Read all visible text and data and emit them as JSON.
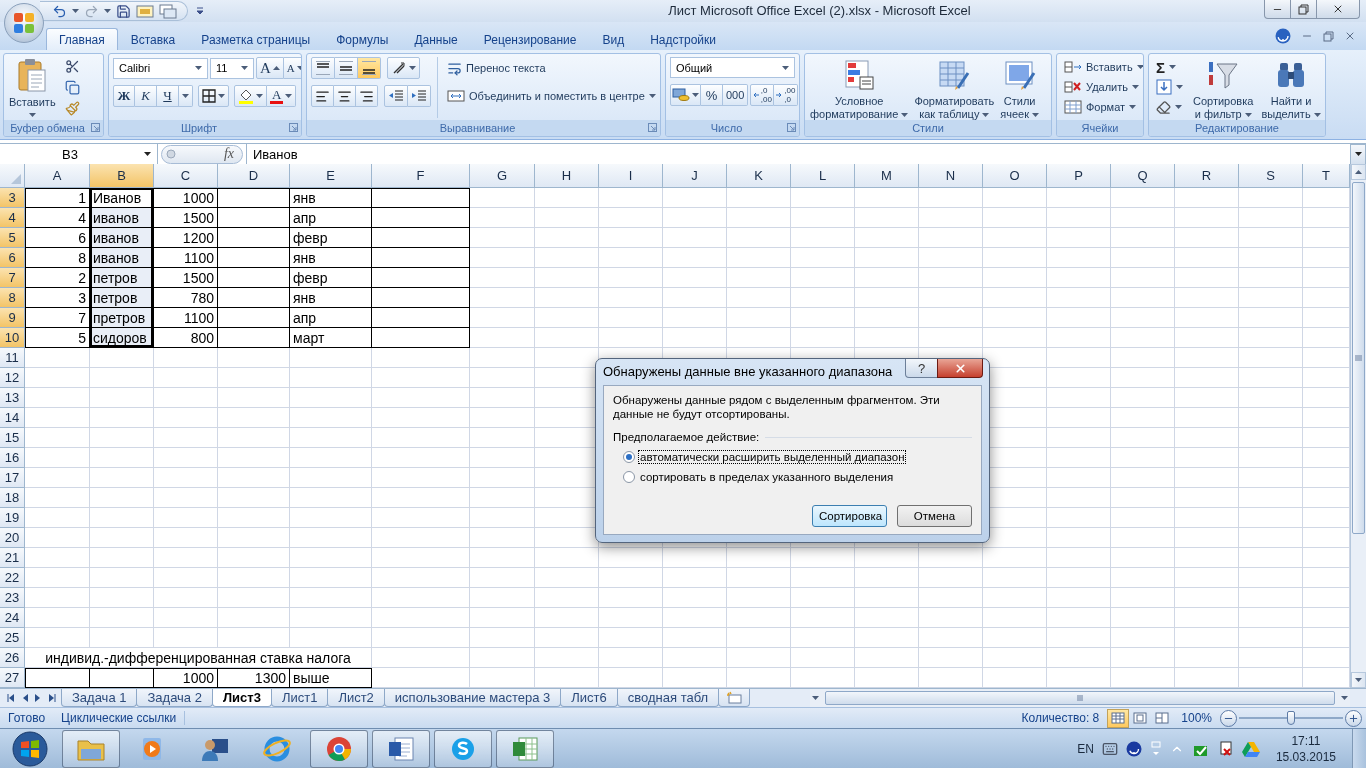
{
  "title_bar": {
    "title": "Лист Microsoft Office Excel (2).xlsx - Microsoft Excel"
  },
  "ribbon_tabs": [
    {
      "label": "Главная",
      "selected": true
    },
    {
      "label": "Вставка",
      "selected": false
    },
    {
      "label": "Разметка страницы",
      "selected": false
    },
    {
      "label": "Формулы",
      "selected": false
    },
    {
      "label": "Данные",
      "selected": false
    },
    {
      "label": "Рецензирование",
      "selected": false
    },
    {
      "label": "Вид",
      "selected": false
    },
    {
      "label": "Надстройки",
      "selected": false
    }
  ],
  "ribbon_groups": [
    {
      "kind": "clipboard",
      "label": "Буфер обмена",
      "paste": "Вставить"
    },
    {
      "kind": "font",
      "label": "Шрифт",
      "font": "Calibri",
      "size": "11",
      "grow": "A",
      "shrink": "A",
      "bold": "Ж",
      "italic": "К",
      "underline": "Ч",
      "font_color": "A"
    },
    {
      "kind": "alignment",
      "label": "Выравнивание",
      "vertical": [
        {
          "selected": false
        },
        {
          "selected": false
        },
        {
          "selected": true
        }
      ],
      "wrap": "Перенос текста",
      "merge": "Объединить и поместить в центре"
    },
    {
      "kind": "number",
      "label": "Число",
      "format": "Общий",
      "percent": "%",
      "thousands": "000",
      "decimals": [
        {
          "top": ",0",
          "bottom": ",00"
        },
        {
          "top": ",00",
          "bottom": ",0"
        }
      ]
    },
    {
      "kind": "styles",
      "label": "Стили",
      "buttons": [
        {
          "lines": [
            "Условное",
            "форматирование"
          ]
        },
        {
          "lines": [
            "Форматировать",
            "как таблицу"
          ]
        },
        {
          "lines": [
            "Стили",
            "ячеек"
          ]
        }
      ]
    },
    {
      "kind": "cells",
      "label": "Ячейки",
      "buttons": [
        "Вставить",
        "Удалить",
        "Формат"
      ]
    },
    {
      "kind": "editing",
      "label": "Редактирование",
      "sum": "Σ",
      "buttons": [
        {
          "lines": [
            "Сортировка",
            "и фильтр"
          ]
        },
        {
          "lines": [
            "Найти и",
            "выделить"
          ]
        }
      ]
    }
  ],
  "formula_bar": {
    "name_box": "B3",
    "function_label": "fx",
    "value": "Иванов"
  },
  "sheet": {
    "columns": [
      {
        "label": "A",
        "selected": false
      },
      {
        "label": "B",
        "selected": true
      },
      {
        "label": "C",
        "selected": false
      },
      {
        "label": "D",
        "selected": false
      },
      {
        "label": "E",
        "selected": false
      },
      {
        "label": "F",
        "selected": false
      },
      {
        "label": "G",
        "selected": false
      },
      {
        "label": "H",
        "selected": false
      },
      {
        "label": "I",
        "selected": false
      },
      {
        "label": "J",
        "selected": false
      },
      {
        "label": "K",
        "selected": false
      },
      {
        "label": "L",
        "selected": false
      },
      {
        "label": "M",
        "selected": false
      },
      {
        "label": "N",
        "selected": false
      },
      {
        "label": "O",
        "selected": false
      },
      {
        "label": "P",
        "selected": false
      },
      {
        "label": "Q",
        "selected": false
      },
      {
        "label": "R",
        "selected": false
      },
      {
        "label": "S",
        "selected": false
      },
      {
        "label": "T",
        "selected": false
      }
    ],
    "rows": [
      {
        "number": "3",
        "selected": true,
        "cells": [
          {
            "value": "1",
            "kind": "number",
            "bordered": true
          },
          {
            "value": "Иванов",
            "kind": "text",
            "bordered": true
          },
          {
            "value": "1000",
            "kind": "number",
            "bordered": true
          },
          {
            "bordered": true
          },
          {
            "value": "янв",
            "kind": "text",
            "bordered": true
          },
          {
            "bordered": true
          }
        ]
      },
      {
        "number": "4",
        "selected": true,
        "cells": [
          {
            "value": "4",
            "kind": "number",
            "bordered": true
          },
          {
            "value": "иванов",
            "kind": "text",
            "bordered": true
          },
          {
            "value": "1500",
            "kind": "number",
            "bordered": true
          },
          {
            "bordered": true
          },
          {
            "value": "апр",
            "kind": "text",
            "bordered": true
          },
          {
            "bordered": true
          }
        ]
      },
      {
        "number": "5",
        "selected": true,
        "cells": [
          {
            "value": "6",
            "kind": "number",
            "bordered": true
          },
          {
            "value": "иванов",
            "kind": "text",
            "bordered": true
          },
          {
            "value": "1200",
            "kind": "number",
            "bordered": true
          },
          {
            "bordered": true
          },
          {
            "value": "февр",
            "kind": "text",
            "bordered": true
          },
          {
            "bordered": true
          }
        ]
      },
      {
        "number": "6",
        "selected": true,
        "cells": [
          {
            "value": "8",
            "kind": "number",
            "bordered": true
          },
          {
            "value": "иванов",
            "kind": "text",
            "bordered": true
          },
          {
            "value": "1100",
            "kind": "number",
            "bordered": true
          },
          {
            "bordered": true
          },
          {
            "value": "янв",
            "kind": "text",
            "bordered": true
          },
          {
            "bordered": true
          }
        ]
      },
      {
        "number": "7",
        "selected": true,
        "cells": [
          {
            "value": "2",
            "kind": "number",
            "bordered": true
          },
          {
            "value": "петров",
            "kind": "text",
            "bordered": true
          },
          {
            "value": "1500",
            "kind": "number",
            "bordered": true
          },
          {
            "bordered": true
          },
          {
            "value": "февр",
            "kind": "text",
            "bordered": true
          },
          {
            "bordered": true
          }
        ]
      },
      {
        "number": "8",
        "selected": true,
        "cells": [
          {
            "value": "3",
            "kind": "number",
            "bordered": true
          },
          {
            "value": "петров",
            "kind": "text",
            "bordered": true
          },
          {
            "value": "780",
            "kind": "number",
            "bordered": true
          },
          {
            "bordered": true
          },
          {
            "value": "янв",
            "kind": "text",
            "bordered": true
          },
          {
            "bordered": true
          }
        ]
      },
      {
        "number": "9",
        "selected": true,
        "cells": [
          {
            "value": "7",
            "kind": "number",
            "bordered": true
          },
          {
            "value": "претров",
            "kind": "text",
            "bordered": true
          },
          {
            "value": "1100",
            "kind": "number",
            "bordered": true
          },
          {
            "bordered": true
          },
          {
            "value": "апр",
            "kind": "text",
            "bordered": true
          },
          {
            "bordered": true
          }
        ]
      },
      {
        "number": "10",
        "selected": true,
        "cells": [
          {
            "value": "5",
            "kind": "number",
            "bordered": true
          },
          {
            "value": "сидоров",
            "kind": "text",
            "bordered": true
          },
          {
            "value": "800",
            "kind": "number",
            "bordered": true
          },
          {
            "bordered": true
          },
          {
            "value": "март",
            "kind": "text",
            "bordered": true
          },
          {
            "bordered": true
          }
        ]
      },
      {
        "number": "11",
        "selected": false
      },
      {
        "number": "12",
        "selected": false
      },
      {
        "number": "13",
        "selected": false
      },
      {
        "number": "14",
        "selected": false
      },
      {
        "number": "15",
        "selected": false
      },
      {
        "number": "16",
        "selected": false
      },
      {
        "number": "17",
        "selected": false
      },
      {
        "number": "18",
        "selected": false
      },
      {
        "number": "19",
        "selected": false
      },
      {
        "number": "20",
        "selected": false
      },
      {
        "number": "21",
        "selected": false
      },
      {
        "number": "22",
        "selected": false
      },
      {
        "number": "23",
        "selected": false
      },
      {
        "number": "24",
        "selected": false
      },
      {
        "number": "25",
        "selected": false
      },
      {
        "number": "26",
        "selected": false,
        "cells": [
          {
            "value": "индивид.-дифференцированная ставка налога",
            "kind": "banner"
          },
          null,
          null,
          null,
          null
        ]
      },
      {
        "number": "27",
        "selected": false,
        "cells": [
          {
            "bordered": true
          },
          {
            "bordered": true
          },
          {
            "value": "1000",
            "kind": "number",
            "bordered": true
          },
          {
            "value": "1300",
            "kind": "number",
            "bordered": true
          },
          {
            "value": "выше",
            "kind": "text",
            "bordered": true
          }
        ]
      }
    ]
  },
  "sheet_tabs": [
    {
      "label": "Задача 1",
      "selected": false
    },
    {
      "label": "Задача 2",
      "selected": false
    },
    {
      "label": "Лист3",
      "selected": true
    },
    {
      "label": "Лист1",
      "selected": false
    },
    {
      "label": "Лист2",
      "selected": false
    },
    {
      "label": "использование мастера 3",
      "selected": false
    },
    {
      "label": "Лист6",
      "selected": false
    },
    {
      "label": "сводная табл",
      "selected": false
    }
  ],
  "status_bar": {
    "mode": "Готово",
    "circular": "Циклические ссылки",
    "count": "Количество: 8",
    "views": [
      {
        "selected": true
      },
      {
        "selected": false
      },
      {
        "selected": false
      }
    ],
    "zoom": "100%",
    "zoom_slider": {
      "level": 0.5
    }
  },
  "taskbar": {
    "apps": [
      {
        "kind": "folder",
        "running": true
      },
      {
        "kind": "player",
        "running": false
      },
      {
        "kind": "user",
        "running": false
      },
      {
        "kind": "ie",
        "running": false
      },
      {
        "kind": "chrome",
        "running": true
      },
      {
        "kind": "word",
        "running": true
      },
      {
        "kind": "skype",
        "running": true
      },
      {
        "kind": "excel",
        "running": true
      }
    ],
    "language": "EN",
    "time": "17:11",
    "date": "15.03.2015"
  },
  "dialog": {
    "title": "Обнаружены данные вне указанного диапазона",
    "help": "?",
    "message": "Обнаружены данные рядом с выделенным фрагментом. Эти данные не будут отсортированы.",
    "prompt": "Предполагаемое действие:",
    "options": [
      {
        "label": "автоматически расширить выделенный диапазон",
        "selected": true,
        "focused": true
      },
      {
        "label": "сортировать в пределах указанного выделения",
        "selected": false,
        "focused": false
      }
    ],
    "buttons": [
      {
        "label": "Сортировка",
        "default": true
      },
      {
        "label": "Отмена",
        "default": false
      }
    ]
  }
}
